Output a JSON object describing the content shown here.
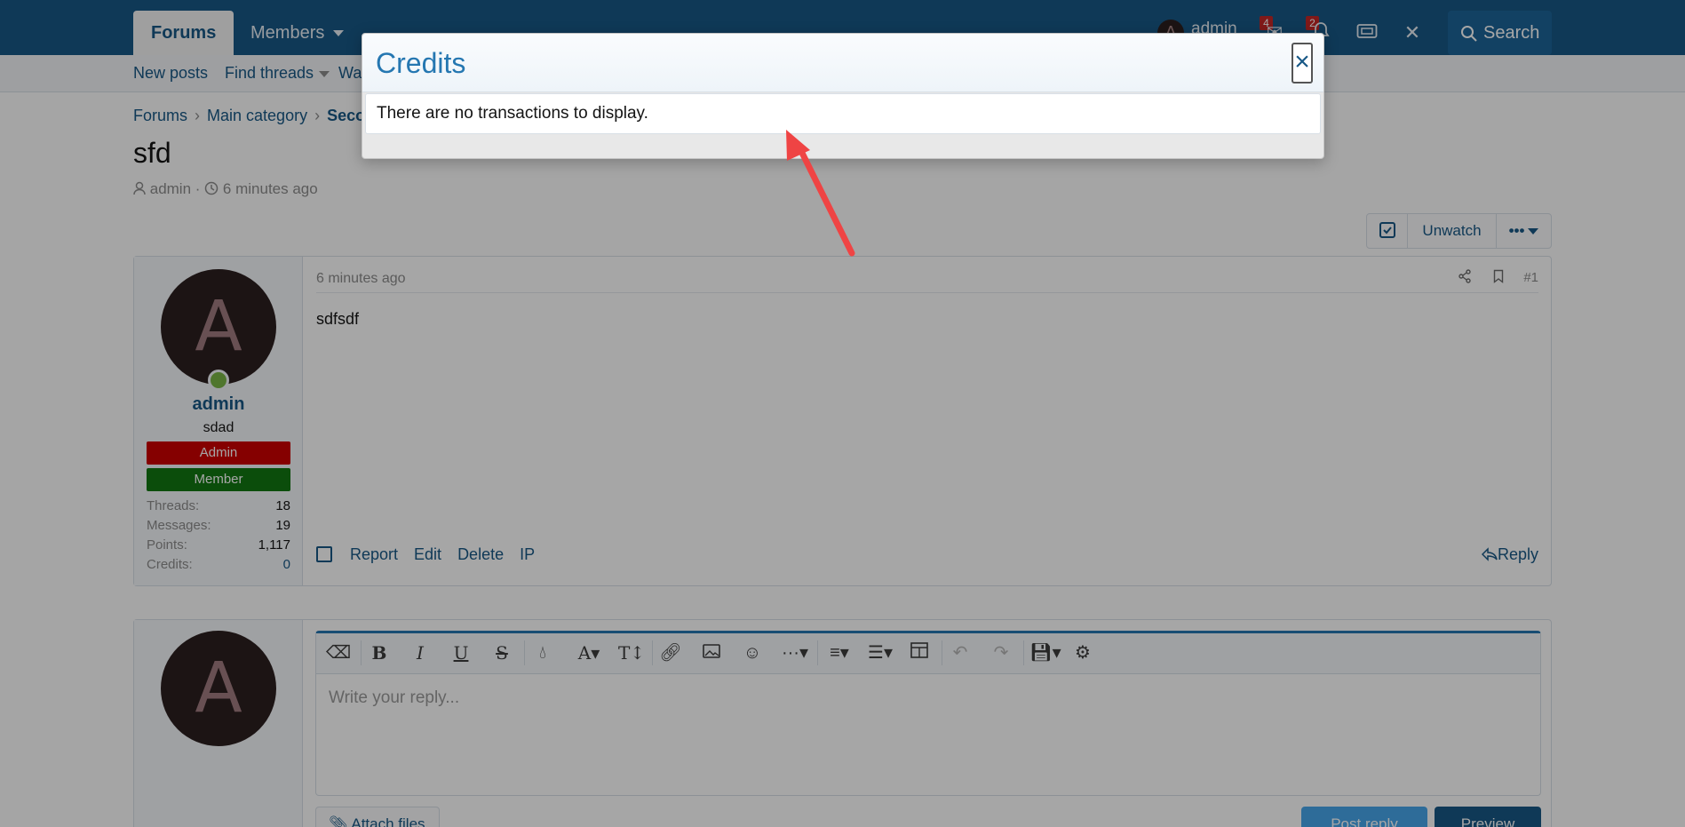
{
  "header": {
    "tabs": [
      {
        "label": "Forums"
      },
      {
        "label": "Members"
      }
    ],
    "user_name": "admin",
    "user_initial": "A",
    "inbox_count": "4",
    "alerts_count": "2",
    "search_label": "Search"
  },
  "subnav": {
    "items": [
      {
        "label": "New posts"
      },
      {
        "label": "Find threads"
      },
      {
        "label": "Wa"
      }
    ]
  },
  "breadcrumb": {
    "items": [
      {
        "label": "Forums"
      },
      {
        "label": "Main category"
      },
      {
        "label": "Seco"
      }
    ]
  },
  "thread": {
    "title": "sfd",
    "author": "admin",
    "time": "6 minutes ago",
    "separator": "·",
    "unwatch_label": "Unwatch"
  },
  "post": {
    "date": "6 minutes ago",
    "number": "#1",
    "body": "sdfsdf",
    "actions": [
      {
        "label": "Report"
      },
      {
        "label": "Edit"
      },
      {
        "label": "Delete"
      },
      {
        "label": "IP"
      }
    ],
    "reply_label": "Reply",
    "user": {
      "initial": "A",
      "name": "admin",
      "title": "sdad",
      "banners": [
        {
          "label": "Admin",
          "color": "#cc0000"
        },
        {
          "label": "Member",
          "color": "#117711"
        }
      ],
      "stats": [
        {
          "label": "Threads:",
          "value": "18"
        },
        {
          "label": "Messages:",
          "value": "19"
        },
        {
          "label": "Points:",
          "value": "1,117"
        },
        {
          "label": "Credits:",
          "value": "0"
        }
      ]
    }
  },
  "reply": {
    "avatar_initial": "A",
    "placeholder": "Write your reply...",
    "attach_label": "Attach files",
    "post_reply_label": "Post reply",
    "preview_label": "Preview"
  },
  "dialog": {
    "title": "Credits",
    "message": "There are no transactions to display.",
    "close_symbol": "×"
  },
  "colors": {
    "brand": "#185886",
    "accent": "#2577b1",
    "annotation_arrow": "#ef4444"
  }
}
